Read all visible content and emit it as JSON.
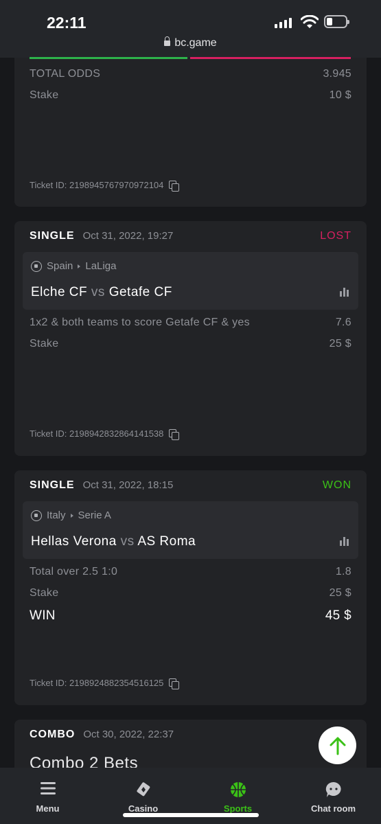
{
  "statusbar": {
    "time": "22:11",
    "url": "bc.game"
  },
  "card0": {
    "total_odds_label": "TOTAL ODDS",
    "total_odds_value": "3.945",
    "stake_label": "Stake",
    "stake_value": "10 $",
    "ticket": "Ticket ID: 2198945767970972104"
  },
  "card1": {
    "type": "SINGLE",
    "date": "Oct 31, 2022, 19:27",
    "status": "LOST",
    "country": "Spain",
    "league": "LaLiga",
    "home": "Elche CF",
    "vs": "vs",
    "away": "Getafe CF",
    "market": "1x2 & both teams to score Getafe CF & yes",
    "odds": "7.6",
    "stake_label": "Stake",
    "stake_value": "25 $",
    "ticket": "Ticket ID: 2198942832864141538"
  },
  "card2": {
    "type": "SINGLE",
    "date": "Oct 31, 2022, 18:15",
    "status": "WON",
    "country": "Italy",
    "league": "Serie A",
    "home": "Hellas Verona",
    "vs": "vs",
    "away": "AS Roma",
    "market": "Total over 2.5  1:0",
    "odds": "1.8",
    "stake_label": "Stake",
    "stake_value": "25 $",
    "win_label": "WIN",
    "win_value": "45 $",
    "ticket": "Ticket ID: 2198924882354516125"
  },
  "card3": {
    "type": "COMBO",
    "date": "Oct 30, 2022, 22:37",
    "title": "Combo 2 Bets"
  },
  "nav": {
    "menu": "Menu",
    "casino": "Casino",
    "sports": "Sports",
    "chat": "Chat room"
  },
  "colors": {
    "lost": "#d62060",
    "won": "#3bc117",
    "accent_green": "#2db24a"
  }
}
